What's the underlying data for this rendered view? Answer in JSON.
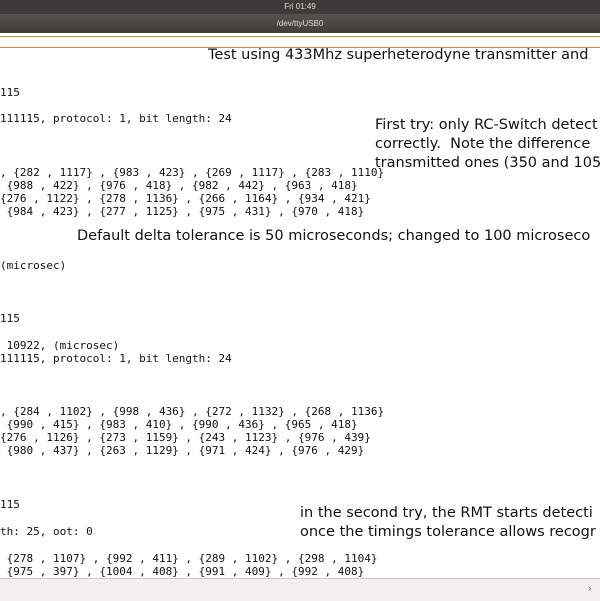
{
  "system": {
    "clock": "Fri 01:49"
  },
  "window": {
    "title": "/dev/ttyUSB0"
  },
  "notes": {
    "header": "Test using 433Mhz superheterodyne transmitter and",
    "first_try": "First try: only RC-Switch detect\ncorrectly.  Note the difference\ntransmitted ones (350 and 105",
    "tolerance": "Default delta tolerance is 50 microseconds; changed to 100 microseco",
    "second_try": "in the second try, the RMT starts detecti\nonce the timings tolerance allows recogr"
  },
  "terminal": {
    "lines": [
      "115",
      "111115, protocol: 1, bit length: 24",
      ", {282 , 1117} , {983 , 423} , {269 , 1117} , {283 , 1110}",
      " {988 , 422} , {976 , 418} , {982 , 442} , {963 , 418}",
      "{276 , 1122} , {278 , 1136} , {266 , 1164} , {934 , 421}",
      " {984 , 423} , {277 , 1125} , {975 , 431} , {970 , 418}",
      "(microsec)",
      "115",
      " 10922, (microsec)",
      "111115, protocol: 1, bit length: 24",
      ", {284 , 1102} , {998 , 436} , {272 , 1132} , {268 , 1136}",
      " {990 , 415} , {983 , 410} , {990 , 436} , {965 , 418}",
      "{276 , 1126} , {273 , 1159} , {243 , 1123} , {976 , 439}",
      " {980 , 437} , {263 , 1129} , {971 , 424} , {976 , 429}",
      "115",
      "th: 25, oot: 0",
      " {278 , 1107} , {992 , 411} , {289 , 1102} , {298 , 1104}",
      " {975 , 397} , {1004 , 408} , {991 , 409} , {992 , 408}"
    ]
  },
  "scrollbar": {
    "arrow_icon": "chevron-right-icon"
  }
}
